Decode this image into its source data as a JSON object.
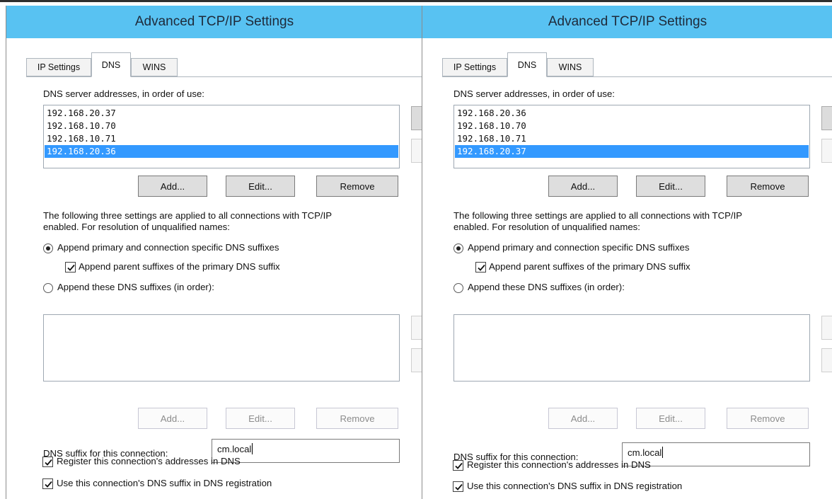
{
  "dialogs": [
    {
      "title": "Advanced TCP/IP Settings",
      "tabs": [
        "IP Settings",
        "DNS",
        "WINS"
      ],
      "active_tab": "DNS",
      "dns_servers_label": "DNS server addresses, in order of use:",
      "dns_servers": [
        "192.168.20.37",
        "192.168.10.70",
        "192.168.10.71",
        "192.168.20.36"
      ],
      "selected_server": "192.168.20.36",
      "server_buttons": {
        "add": "Add...",
        "edit": "Edit...",
        "remove": "Remove"
      },
      "info_line1": "The following three settings are applied to all connections with TCP/IP",
      "info_line2": "enabled. For resolution of unqualified names:",
      "radio_primary": "Append primary and connection specific DNS suffixes",
      "check_parent": "Append parent suffixes of the primary DNS suffix",
      "radio_these": "Append these DNS suffixes (in order):",
      "suffix_buttons": {
        "add": "Add...",
        "edit": "Edit...",
        "remove": "Remove"
      },
      "suffix_label": "DNS suffix for this connection:",
      "suffix_value": "cm.local",
      "check_register": "Register this connection's addresses in DNS",
      "check_use_suffix": "Use this connection's DNS suffix in DNS registration"
    },
    {
      "title": "Advanced TCP/IP Settings",
      "tabs": [
        "IP Settings",
        "DNS",
        "WINS"
      ],
      "active_tab": "DNS",
      "dns_servers_label": "DNS server addresses, in order of use:",
      "dns_servers": [
        "192.168.20.36",
        "192.168.10.70",
        "192.168.10.71",
        "192.168.20.37"
      ],
      "selected_server": "192.168.20.37",
      "server_buttons": {
        "add": "Add...",
        "edit": "Edit...",
        "remove": "Remove"
      },
      "info_line1": "The following three settings are applied to all connections with TCP/IP",
      "info_line2": "enabled. For resolution of unqualified names:",
      "radio_primary": "Append primary and connection specific DNS suffixes",
      "check_parent": "Append parent suffixes of the primary DNS suffix",
      "radio_these": "Append these DNS suffixes (in order):",
      "suffix_buttons": {
        "add": "Add...",
        "edit": "Edit...",
        "remove": "Remove"
      },
      "suffix_label": "DNS suffix for this connection:",
      "suffix_value": "cm.local",
      "check_register": "Register this connection's addresses in DNS",
      "check_use_suffix": "Use this connection's DNS suffix in DNS registration"
    }
  ],
  "colors": {
    "title_bar": "#58c2f2",
    "selection": "#3399ff"
  }
}
